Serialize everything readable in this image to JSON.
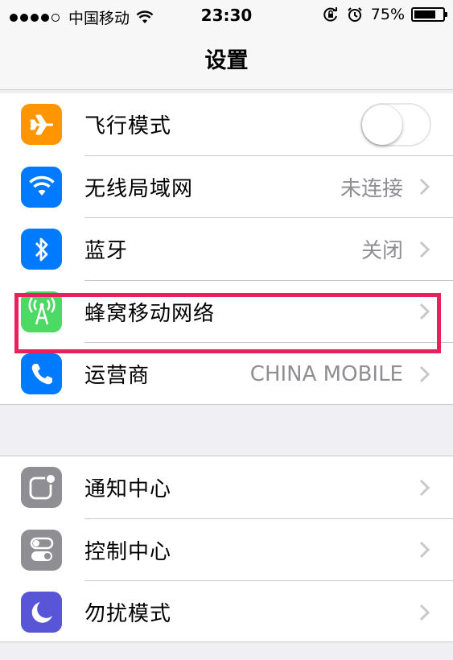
{
  "status_bar": {
    "carrier": "中国移动",
    "time": "23:30",
    "battery": "75%",
    "battery_level": 0.75,
    "signal_bars": 4
  },
  "nav": {
    "title": "设置"
  },
  "groups": [
    {
      "rows": [
        {
          "label": "飞行模式",
          "icon": "airplane-icon",
          "icon_color": "#ff9500",
          "control": "toggle",
          "toggle_on": false
        },
        {
          "label": "无线局域网",
          "value": "未连接",
          "icon": "wifi-icon",
          "icon_color": "#007aff"
        },
        {
          "label": "蓝牙",
          "value": "关闭",
          "icon": "bluetooth-icon",
          "icon_color": "#007aff"
        },
        {
          "label": "蜂窝移动网络",
          "value": "",
          "icon": "cellular-antenna-icon",
          "icon_color": "#4cd964",
          "highlighted": true
        },
        {
          "label": "运营商",
          "value": "CHINA MOBILE",
          "icon": "phone-icon",
          "icon_color": "#007aff"
        }
      ]
    },
    {
      "rows": [
        {
          "label": "通知中心",
          "icon": "notification-center-icon",
          "icon_color": "#8e8e93"
        },
        {
          "label": "控制中心",
          "icon": "control-center-icon",
          "icon_color": "#8e8e93"
        },
        {
          "label": "勿扰模式",
          "icon": "moon-icon",
          "icon_color": "#5856d6"
        }
      ]
    }
  ],
  "colors": {
    "highlight_border": "#e8205c",
    "chevron": "#c7c7cc",
    "secondary_text": "#8e8e93"
  }
}
